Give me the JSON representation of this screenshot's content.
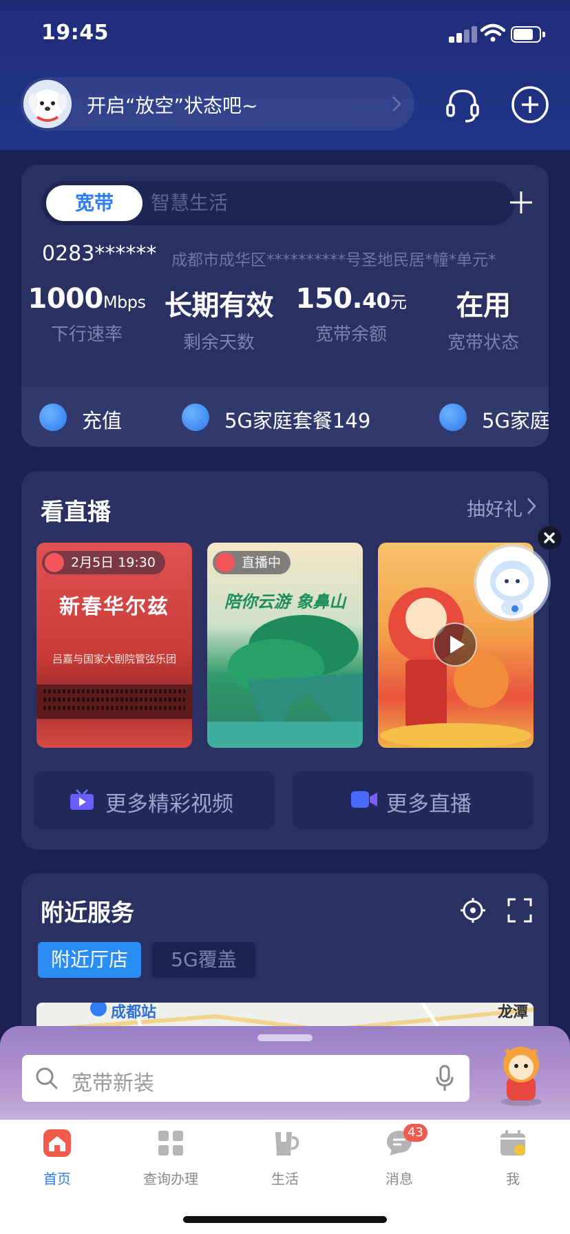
{
  "status_bar": {
    "time": "19:45"
  },
  "header": {
    "greeting": "开启“放空”状态吧~"
  },
  "broadband": {
    "tabs": [
      "宽带",
      "智慧生活"
    ],
    "account": "0283******",
    "address": "成都市成华区**********号圣地民居*幢*单元*",
    "stats": [
      {
        "value": "1000",
        "unit": "Mbps",
        "label": "下行速率"
      },
      {
        "value": "长期有效",
        "unit": "",
        "label": "剩余天数"
      },
      {
        "value": "150.",
        "value_small": "40",
        "unit": "元",
        "label": "宽带余额"
      },
      {
        "value": "在用",
        "unit": "",
        "label": "宽带状态"
      }
    ],
    "quick_actions": [
      "充值",
      "5G家庭套餐149",
      "5G家庭"
    ]
  },
  "live": {
    "title": "看直播",
    "more": "抽好礼",
    "items": [
      {
        "badge": "2月5日 19:30",
        "title": "新春华尔兹",
        "subtitle": "吕嘉与国家大剧院管弦乐团"
      },
      {
        "badge": "直播中",
        "title": "陪你云游 象鼻山"
      },
      {
        "badge": ""
      }
    ],
    "buttons": [
      "更多精彩视频",
      "更多直播"
    ]
  },
  "nearby": {
    "title": "附近服务",
    "tabs": [
      "附近厅店",
      "5G覆盖"
    ],
    "map_labels": [
      "成都站",
      "龙潭"
    ]
  },
  "search": {
    "placeholder": "宽带新装"
  },
  "bottom_nav": {
    "items": [
      {
        "label": "首页",
        "active": true
      },
      {
        "label": "查询办理",
        "active": false
      },
      {
        "label": "生活",
        "active": false
      },
      {
        "label": "消息",
        "active": false,
        "badge": "43"
      },
      {
        "label": "我",
        "active": false
      }
    ]
  },
  "colors": {
    "accent": "#2f7df6",
    "card": "#2a3162",
    "page": "#1b2152",
    "header": "#213487",
    "badge_red": "#f05a4f"
  }
}
